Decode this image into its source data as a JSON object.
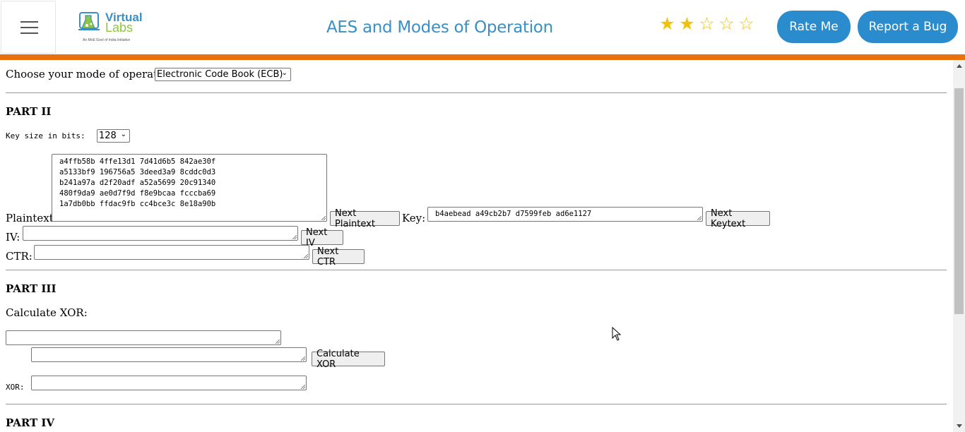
{
  "header": {
    "title": "AES and Modes of Operation",
    "logo_text_top": "Virtual",
    "logo_text_bottom": "Labs",
    "logo_tagline": "An MoE Govt of India Initiative",
    "rating": {
      "filled": 2,
      "total": 5
    },
    "rate_button": "Rate Me",
    "bug_button": "Report a Bug",
    "accent_color": "#e8700f",
    "brand_color": "#2a8ccd"
  },
  "mode": {
    "label": "Choose your mode of operation:",
    "selected": "Electronic Code Book (ECB)"
  },
  "part2": {
    "heading": "PART II",
    "key_size_label": "Key size in bits:",
    "key_size_selected": "128",
    "plaintext_label": "Plaintext:",
    "plaintext_value": "a4ffb58b 4ffe13d1 7d41d6b5 842ae30f\na5133bf9 196756a5 3deed3a9 8cddc0d3\nb241a97a d2f20adf a52a5699 20c91340\n480f9da9 ae0d7f9d f8e9bcaa fcccba69\n1a7db0bb ffdac9fb cc4bce3c 8e18a90b",
    "next_plaintext": "Next Plaintext",
    "key_label": "Key:",
    "key_value": "b4aebead a49cb2b7 d7599feb ad6e1127",
    "next_keytext": "Next Keytext",
    "iv_label": "IV:",
    "iv_value": "",
    "next_iv": "Next IV",
    "ctr_label": "CTR:",
    "ctr_value": "",
    "next_ctr": "Next CTR"
  },
  "part3": {
    "heading": "PART III",
    "calc_label": "Calculate XOR:",
    "input1": "",
    "input2": "",
    "calc_button": "Calculate XOR",
    "xor_label": "XOR:",
    "xor_value": ""
  },
  "part4": {
    "heading": "PART IV"
  }
}
